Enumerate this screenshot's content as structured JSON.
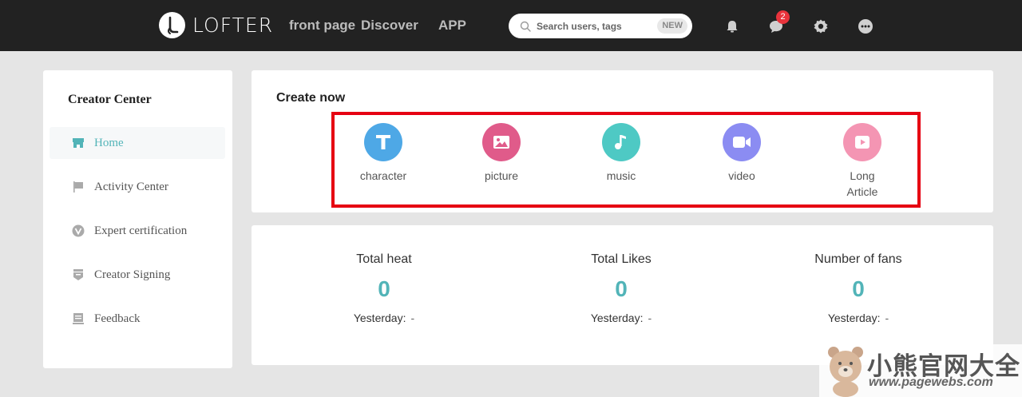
{
  "header": {
    "logo_text": "LOFTER",
    "nav": [
      "front page",
      "Discover",
      "APP"
    ],
    "search_placeholder": "Search users, tags",
    "search_badge": "NEW",
    "message_count": "2",
    "icons": [
      "bell-icon",
      "message-icon",
      "gear-icon",
      "more-icon"
    ]
  },
  "sidebar": {
    "title": "Creator Center",
    "items": [
      {
        "label": "Home",
        "icon": "store-icon",
        "active": true
      },
      {
        "label": "Activity Center",
        "icon": "flag-icon",
        "active": false
      },
      {
        "label": "Expert certification",
        "icon": "verified-icon",
        "active": false
      },
      {
        "label": "Creator Signing",
        "icon": "badge-icon",
        "active": false
      },
      {
        "label": "Feedback",
        "icon": "feedback-icon",
        "active": false
      }
    ]
  },
  "create": {
    "title": "Create now",
    "items": [
      {
        "label": "character",
        "icon": "text-icon",
        "color": "#4ea8e6"
      },
      {
        "label": "picture",
        "icon": "picture-icon",
        "color": "#e05b8a"
      },
      {
        "label": "music",
        "icon": "music-icon",
        "color": "#4ec9c4"
      },
      {
        "label": "video",
        "icon": "video-icon",
        "color": "#8b8cf2"
      },
      {
        "label": "Long",
        "label2": "Article",
        "icon": "play-icon",
        "color": "#f495b3"
      }
    ]
  },
  "stats": [
    {
      "label": "Total heat",
      "value": "0",
      "yesterday_label": "Yesterday:",
      "yesterday_value": "-"
    },
    {
      "label": "Total Likes",
      "value": "0",
      "yesterday_label": "Yesterday:",
      "yesterday_value": "-"
    },
    {
      "label": "Number of fans",
      "value": "0",
      "yesterday_label": "Yesterday:",
      "yesterday_value": "-"
    }
  ],
  "watermark": {
    "title": "小熊官网大全",
    "url": "www.pagewebs.com"
  },
  "colors": {
    "accent": "#52b4b8",
    "topbar": "#222222",
    "highlight": "#e60012"
  }
}
